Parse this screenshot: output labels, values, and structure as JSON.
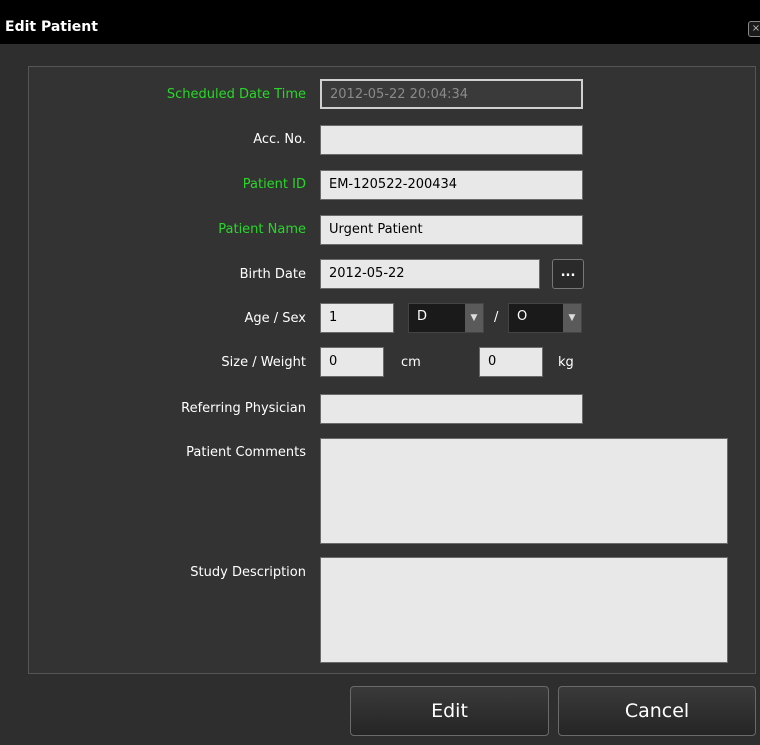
{
  "window": {
    "title": "Edit Patient",
    "close_glyph": "×"
  },
  "fields": {
    "scheduled": {
      "label": "Scheduled Date Time",
      "value": "2012-05-22 20:04:34"
    },
    "acc_no": {
      "label": "Acc. No.",
      "value": ""
    },
    "patient_id": {
      "label": "Patient ID",
      "value": "EM-120522-200434"
    },
    "patient_name": {
      "label": "Patient Name",
      "value": "Urgent Patient"
    },
    "birth_date": {
      "label": "Birth Date",
      "value": "2012-05-22",
      "picker_label": "..."
    },
    "age_sex": {
      "label": "Age / Sex",
      "age": "1",
      "age_unit": "D",
      "separator": "/",
      "sex": "O"
    },
    "size_weight": {
      "label": "Size / Weight",
      "size": "0",
      "size_unit": "cm",
      "weight": "0",
      "weight_unit": "kg"
    },
    "referring": {
      "label": "Referring Physician",
      "value": ""
    },
    "comments": {
      "label": "Patient Comments",
      "value": ""
    },
    "study": {
      "label": "Study Description",
      "value": ""
    }
  },
  "buttons": {
    "edit": "Edit",
    "cancel": "Cancel"
  },
  "colors": {
    "required_label": "#28d828",
    "background": "#2e2e2e",
    "titlebar": "#000000"
  },
  "icons": {
    "combo_arrow": "chevron-down-icon",
    "close": "close-icon"
  }
}
